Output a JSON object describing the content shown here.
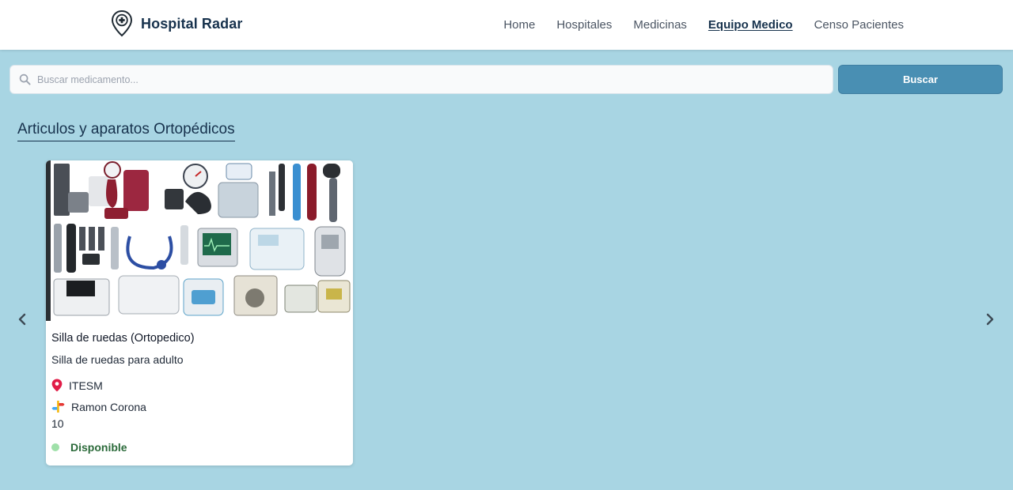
{
  "header": {
    "brand": "Hospital Radar",
    "nav": [
      {
        "label": "Home",
        "active": false
      },
      {
        "label": "Hospitales",
        "active": false
      },
      {
        "label": "Medicinas",
        "active": false
      },
      {
        "label": "Equipo Medico",
        "active": true
      },
      {
        "label": "Censo Pacientes",
        "active": false
      }
    ]
  },
  "search": {
    "placeholder": "Buscar medicamento...",
    "value": "",
    "button_label": "Buscar"
  },
  "section": {
    "title": "Articulos y aparatos Ortopédicos"
  },
  "card": {
    "image_icon": "medical-equipment-collage",
    "title": "Silla de ruedas (Ortopedico)",
    "description": "Silla de ruedas para adulto",
    "location": "ITESM",
    "contact": "Ramon Corona",
    "quantity": "10",
    "status": "Disponible"
  },
  "colors": {
    "background": "#a8d5e3",
    "header": "#ffffff",
    "brand_text": "#17324d",
    "button": "#498fb3",
    "status_dot": "#9fe0a9",
    "status_text": "#2b6a3a",
    "location_pin": "#e11d48"
  }
}
